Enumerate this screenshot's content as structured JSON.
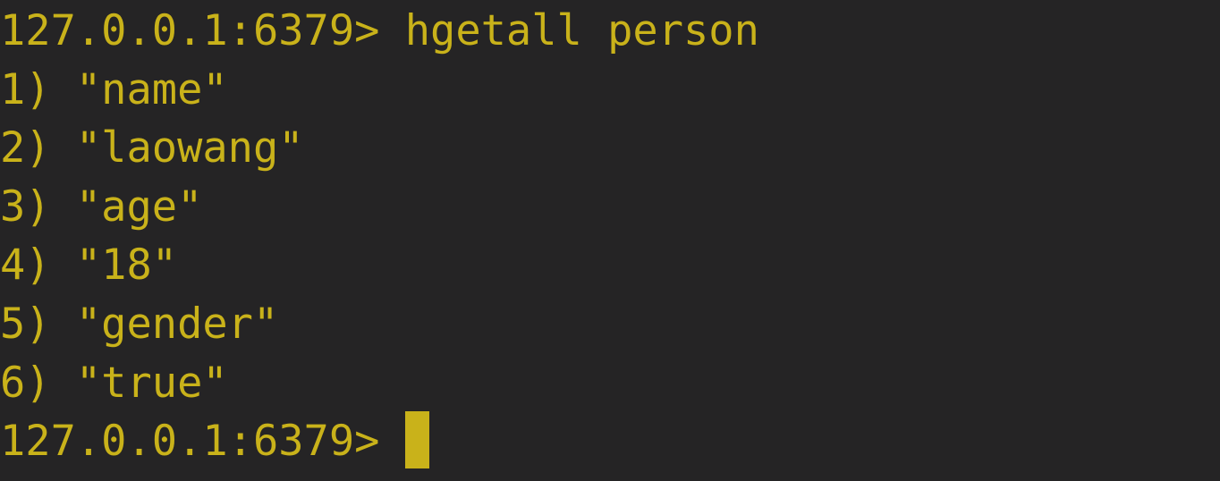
{
  "terminal": {
    "text_color": "#c9b21a",
    "background_color": "#252425",
    "prompt": "127.0.0.1:6379> ",
    "command": "hgetall person",
    "output": [
      "1) \"name\"",
      "2) \"laowang\"",
      "3) \"age\"",
      "4) \"18\"",
      "5) \"gender\"",
      "6) \"true\""
    ],
    "final_prompt": "127.0.0.1:6379> "
  }
}
